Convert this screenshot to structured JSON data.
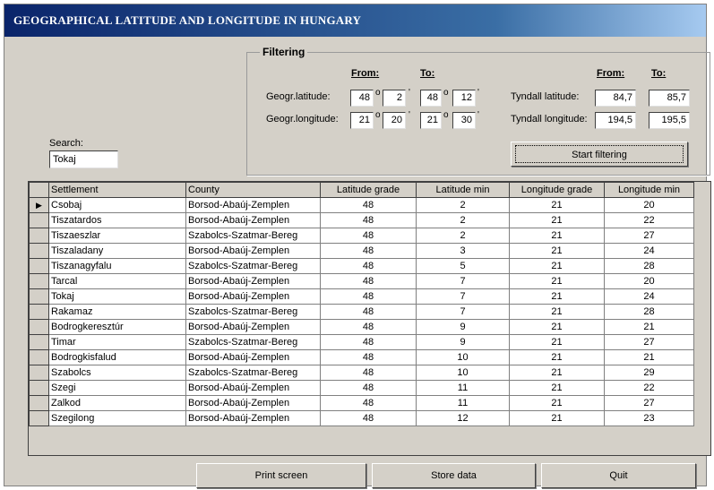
{
  "window": {
    "title": "GEOGRAPHICAL LATITUDE AND LONGITUDE IN HUNGARY"
  },
  "filter": {
    "legend": "Filtering",
    "from_label": "From:",
    "to_label": "To:",
    "lat_label": "Geogr.latitude:",
    "lon_label": "Geogr.longitude:",
    "lat_from_deg": "48",
    "lat_from_min": "2",
    "lat_to_deg": "48",
    "lat_to_min": "12",
    "lon_from_deg": "21",
    "lon_from_min": "20",
    "lon_to_deg": "21",
    "lon_to_min": "30",
    "deg_symbol": "o",
    "min_symbol": "'",
    "tyndall_lat_label": "Tyndall latitude:",
    "tyndall_lon_label": "Tyndall longitude:",
    "tyndall_from_label": "From:",
    "tyndall_to_label": "To:",
    "tyndall_lat_from": "84,7",
    "tyndall_lat_to": "85,7",
    "tyndall_lon_from": "194,5",
    "tyndall_lon_to": "195,5",
    "start_button": "Start filtering"
  },
  "search": {
    "label": "Search:",
    "value": "Tokaj"
  },
  "table": {
    "columns": [
      "Settlement",
      "County",
      "Latitude grade",
      "Latitude min",
      "Longitude grade",
      "Longitude min"
    ],
    "rows": [
      [
        "Csobaj",
        "Borsod-Abaúj-Zemplen",
        "48",
        "2",
        "21",
        "20"
      ],
      [
        "Tiszatardos",
        "Borsod-Abaúj-Zemplen",
        "48",
        "2",
        "21",
        "22"
      ],
      [
        "Tiszaeszlar",
        "Szabolcs-Szatmar-Bereg",
        "48",
        "2",
        "21",
        "27"
      ],
      [
        "Tiszaladany",
        "Borsod-Abaúj-Zemplen",
        "48",
        "3",
        "21",
        "24"
      ],
      [
        "Tiszanagyfalu",
        "Szabolcs-Szatmar-Bereg",
        "48",
        "5",
        "21",
        "28"
      ],
      [
        "Tarcal",
        "Borsod-Abaúj-Zemplen",
        "48",
        "7",
        "21",
        "20"
      ],
      [
        "Tokaj",
        "Borsod-Abaúj-Zemplen",
        "48",
        "7",
        "21",
        "24"
      ],
      [
        "Rakamaz",
        "Szabolcs-Szatmar-Bereg",
        "48",
        "7",
        "21",
        "28"
      ],
      [
        "Bodrogkeresztúr",
        "Borsod-Abaúj-Zemplen",
        "48",
        "9",
        "21",
        "21"
      ],
      [
        "Timar",
        "Szabolcs-Szatmar-Bereg",
        "48",
        "9",
        "21",
        "27"
      ],
      [
        "Bodrogkisfalud",
        "Borsod-Abaúj-Zemplen",
        "48",
        "10",
        "21",
        "21"
      ],
      [
        "Szabolcs",
        "Szabolcs-Szatmar-Bereg",
        "48",
        "10",
        "21",
        "29"
      ],
      [
        "Szegi",
        "Borsod-Abaúj-Zemplen",
        "48",
        "11",
        "21",
        "22"
      ],
      [
        "Zalkod",
        "Borsod-Abaúj-Zemplen",
        "48",
        "11",
        "21",
        "27"
      ],
      [
        "Szegilong",
        "Borsod-Abaúj-Zemplen",
        "48",
        "12",
        "21",
        "23"
      ]
    ],
    "current_row_marker": "▶"
  },
  "buttons": {
    "print": "Print screen",
    "store": "Store data",
    "quit": "Quit"
  }
}
